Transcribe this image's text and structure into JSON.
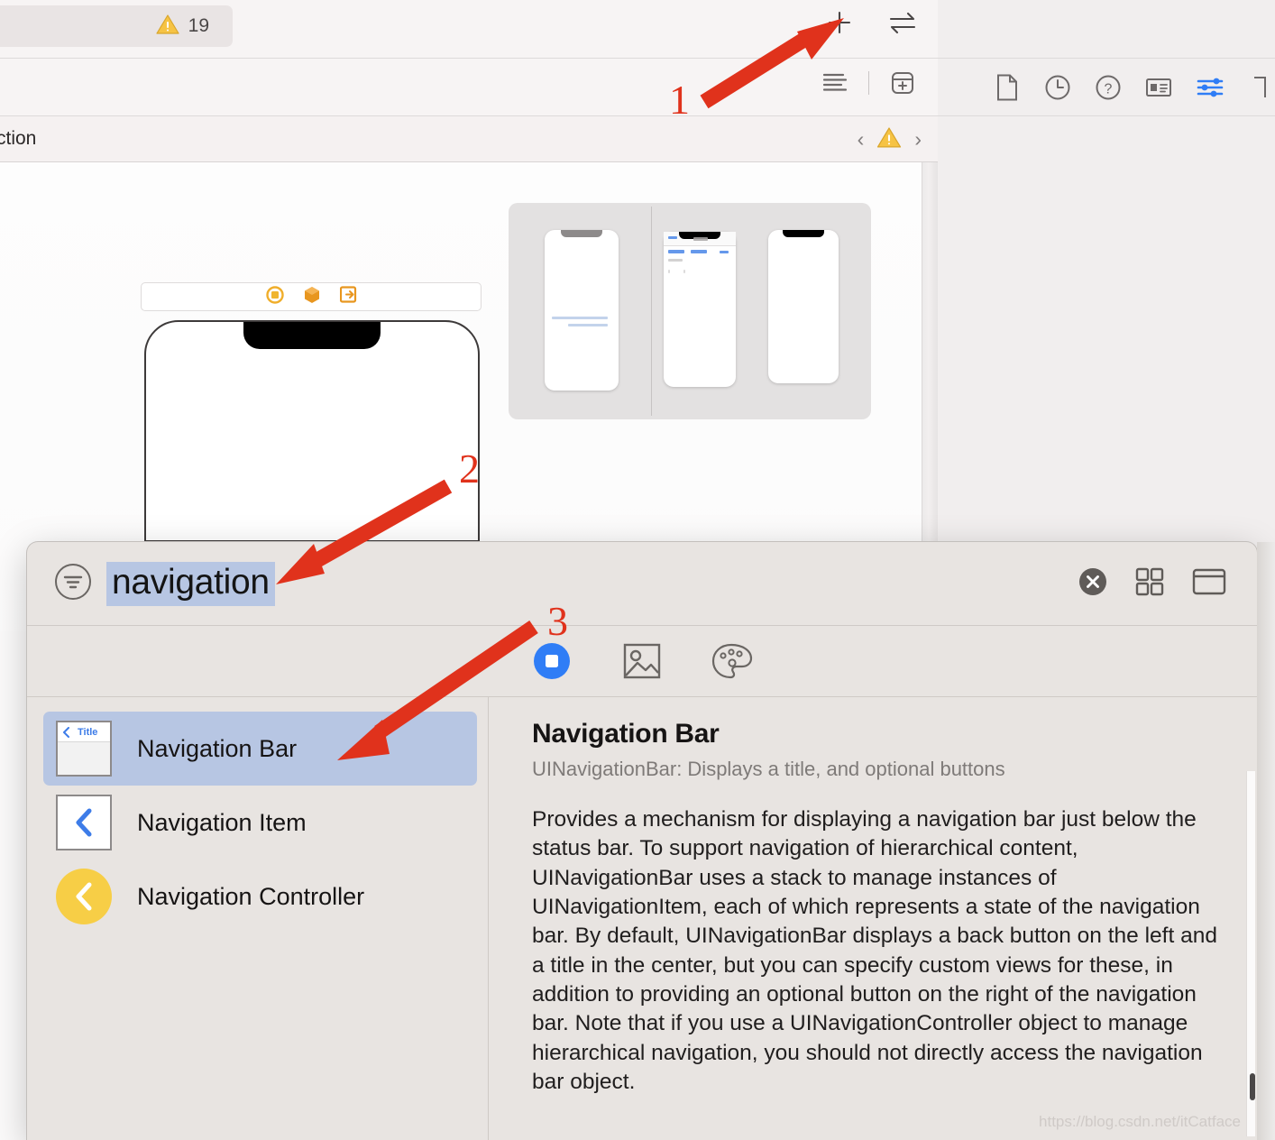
{
  "toolbar": {
    "warning_count": "19",
    "warning_icon": "warning-triangle-icon",
    "add_label": "+",
    "swap_icon": "swap-arrows-icon"
  },
  "canvas_toolbar": {
    "align_icon": "align-lines-icon",
    "embed_icon": "embed-in-box-icon"
  },
  "jumpbar": {
    "breadcrumb_text": "ction",
    "prev_icon": "chevron-left-icon",
    "warning_icon": "warning-triangle-icon",
    "next_icon": "chevron-right-icon"
  },
  "inspector": {
    "tabs": [
      {
        "name": "file-inspector",
        "icon": "document-icon"
      },
      {
        "name": "history-inspector",
        "icon": "clock-icon"
      },
      {
        "name": "quick-help-inspector",
        "icon": "question-mark-icon"
      },
      {
        "name": "identity-inspector",
        "icon": "identity-card-icon"
      },
      {
        "name": "attributes-inspector",
        "icon": "sliders-icon",
        "selected": true
      },
      {
        "name": "size-inspector",
        "icon": "ruler-icon"
      }
    ],
    "accent": "#2f7df6"
  },
  "canvas": {
    "scene_dock_icons": [
      "view-controller-circle-icon",
      "first-responder-cube-icon",
      "exit-segue-icon"
    ],
    "device_name": "iphone-canvas-preview",
    "preview_count": "3"
  },
  "library": {
    "search": {
      "value": "navigation",
      "filter_icon": "filter-icon",
      "clear_icon": "close-circle-icon"
    },
    "header_buttons": [
      {
        "name": "grid-view-button",
        "icon": "grid-icon"
      },
      {
        "name": "detail-view-button",
        "icon": "panel-icon"
      }
    ],
    "tabs": [
      {
        "name": "objects-tab",
        "icon": "object-square-icon",
        "selected": true
      },
      {
        "name": "media-tab",
        "icon": "image-icon",
        "selected": false
      },
      {
        "name": "color-tab",
        "icon": "palette-icon",
        "selected": false
      }
    ],
    "items": [
      {
        "label": "Navigation Bar",
        "icon": "navigation-bar-thumb",
        "thumb_title": "Title",
        "selected": true
      },
      {
        "label": "Navigation Item",
        "icon": "navigation-item-thumb",
        "selected": false
      },
      {
        "label": "Navigation Controller",
        "icon": "navigation-controller-thumb",
        "selected": false
      }
    ],
    "detail": {
      "title": "Navigation Bar",
      "subtitle": "UINavigationBar: Displays a title, and optional buttons",
      "body": "Provides a mechanism for displaying a navigation bar just below the status bar. To support navigation of hierarchical content, UINavigationBar uses a stack to manage instances of UINavigationItem, each of which represents a state of the navigation bar. By default, UINavigationBar displays a back button on the left and a title in the center, but you can specify custom views for these, in addition to providing an optional button on the right of the navigation bar. Note that if you use a UINavigationController object to manage hierarchical navigation, you should not directly access the navigation bar object."
    }
  },
  "annotations": {
    "step1": "1",
    "step2": "2",
    "step3": "3",
    "arrow_color": "#e0321c"
  },
  "watermark": "https://blog.csdn.net/itCatface"
}
